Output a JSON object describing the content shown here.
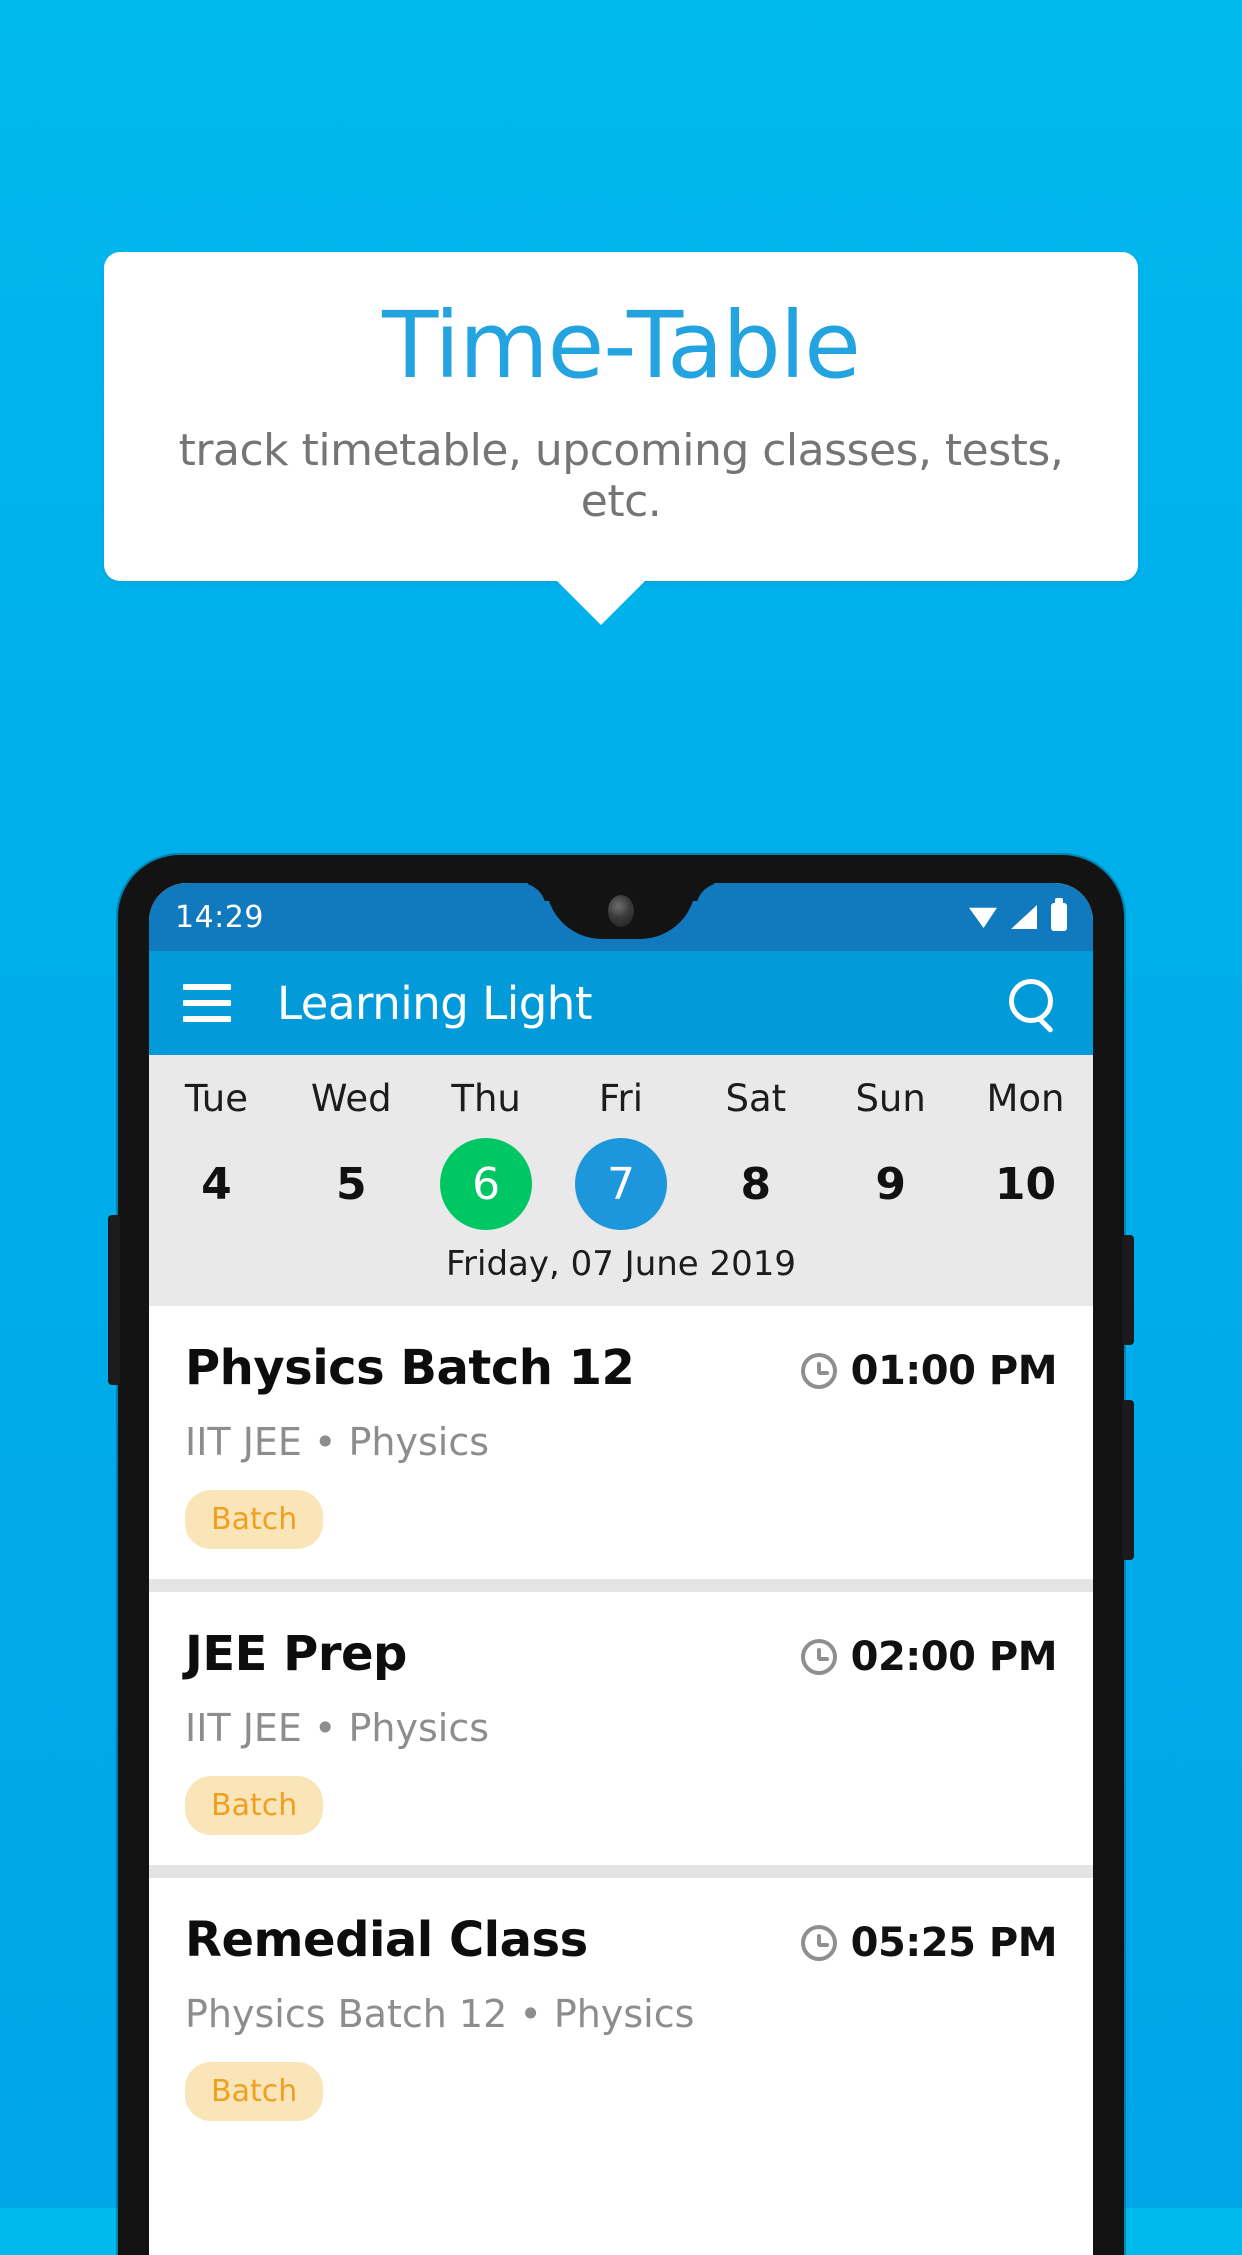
{
  "promo": {
    "title": "Time-Table",
    "subtitle": "track timetable, upcoming classes, tests, etc."
  },
  "colors": {
    "background": "#00aeea",
    "promo_title": "#23a3e0",
    "appbar": "#039ada",
    "statusbar": "#1179bd",
    "today_circle": "#00c764",
    "selected_circle": "#1e96db",
    "chip_bg": "#fae5b8",
    "chip_text": "#efa020"
  },
  "status_bar": {
    "time": "14:29",
    "icons": [
      "wifi-icon",
      "signal-icon",
      "battery-icon"
    ]
  },
  "app_bar": {
    "menu_icon": "hamburger-menu-icon",
    "title": "Learning Light",
    "search_icon": "search-icon"
  },
  "date_strip": {
    "days": [
      {
        "name": "Tue",
        "num": "4",
        "state": "normal"
      },
      {
        "name": "Wed",
        "num": "5",
        "state": "normal"
      },
      {
        "name": "Thu",
        "num": "6",
        "state": "today"
      },
      {
        "name": "Fri",
        "num": "7",
        "state": "selected"
      },
      {
        "name": "Sat",
        "num": "8",
        "state": "normal"
      },
      {
        "name": "Sun",
        "num": "9",
        "state": "normal"
      },
      {
        "name": "Mon",
        "num": "10",
        "state": "normal"
      }
    ],
    "selected_date_label": "Friday, 07 June 2019"
  },
  "schedule": {
    "items": [
      {
        "title": "Physics Batch 12",
        "time": "01:00 PM",
        "subtitle": "IIT JEE • Physics",
        "tag": "Batch",
        "clock_icon": "clock-icon"
      },
      {
        "title": "JEE Prep",
        "time": "02:00 PM",
        "subtitle": "IIT JEE • Physics",
        "tag": "Batch",
        "clock_icon": "clock-icon"
      },
      {
        "title": "Remedial Class",
        "time": "05:25 PM",
        "subtitle": "Physics Batch 12 • Physics",
        "tag": "Batch",
        "clock_icon": "clock-icon"
      }
    ]
  }
}
